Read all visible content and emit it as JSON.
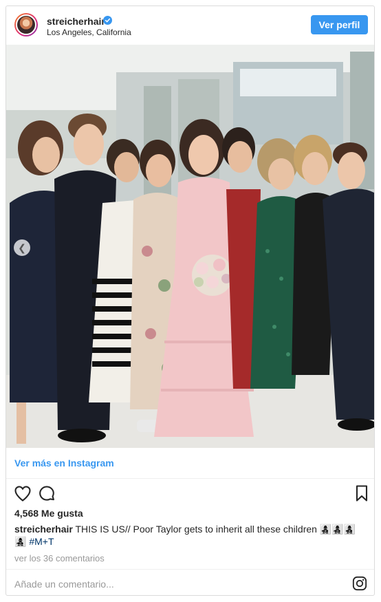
{
  "header": {
    "username": "streicherhair",
    "location": "Los Angeles, California",
    "follow_label": "Ver perfil"
  },
  "photo": {
    "description_colors": {
      "dress": "#f2c6c8",
      "suit": "#1f2533",
      "sequins": "#1f5b43"
    }
  },
  "see_more_label": "Ver más en Instagram",
  "likes_text": "4,568 Me gusta",
  "caption": {
    "username": "streicherhair",
    "text": "THIS IS US// Poor Taylor gets to inherit all these children 👩‍👧‍👦👩‍👧‍👦👩‍👧‍👦👩‍👧‍👦",
    "hashtag": "#M+T"
  },
  "comments_link": "ver los 36 comentarios",
  "comment_placeholder": "Añade un comentario...",
  "icons": [
    "heart-icon",
    "comment-bubble-icon",
    "bookmark-icon",
    "instagram-logo-icon",
    "verified-badge-icon",
    "chevron-left-icon"
  ],
  "colors": {
    "accent": "#3897f0",
    "text": "#262626",
    "muted": "#999999",
    "border": "#dbdbdb"
  }
}
